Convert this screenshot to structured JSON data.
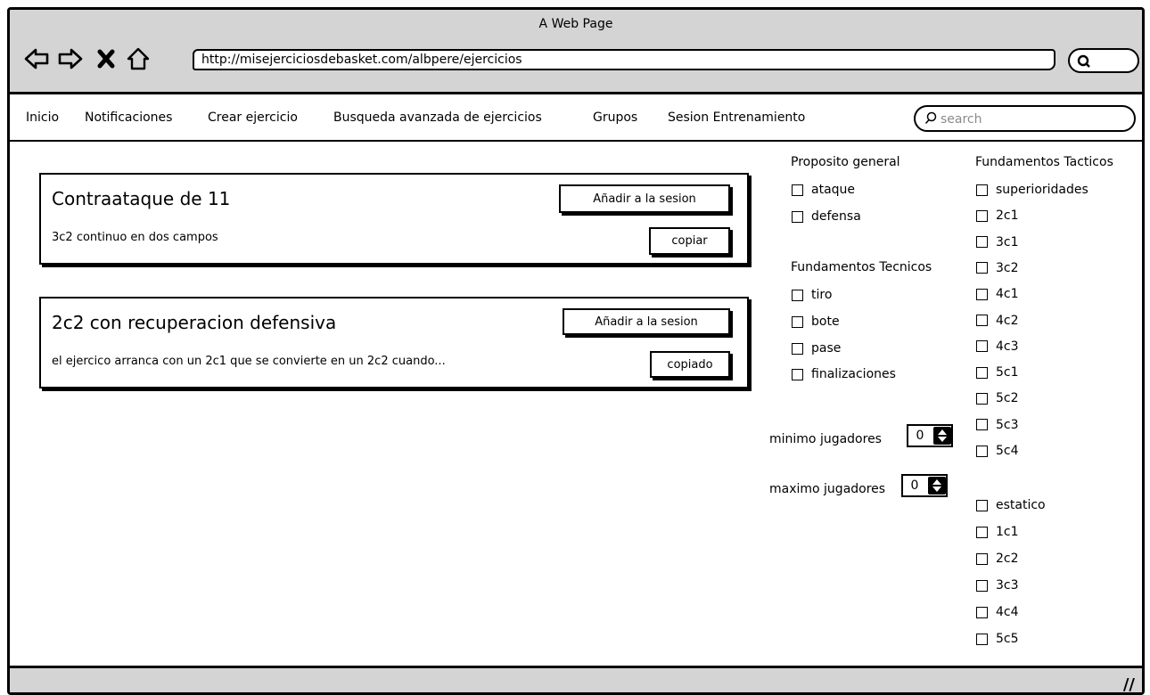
{
  "window": {
    "title": "A Web Page"
  },
  "browser": {
    "url": "http://misejerciciosdebasket.com/albpere/ejercicios",
    "back_icon": "back-arrow-icon",
    "forward_icon": "forward-arrow-icon",
    "stop_icon": "close-icon",
    "home_icon": "home-icon"
  },
  "menu": {
    "items": [
      "Inicio",
      "Notificaciones",
      "Crear ejercicio",
      "Busqueda avanzada de ejercicios",
      "Grupos",
      "Sesion Entrenamiento"
    ],
    "search_placeholder": "search"
  },
  "exercises": [
    {
      "title": "Contraataque de 11",
      "description": "3c2 continuo en dos campos",
      "add_label": "Añadir a la sesion",
      "copy_label": "copiar"
    },
    {
      "title": "2c2 con recuperacion defensiva",
      "description": "el ejercico arranca con un 2c1 que se convierte en un 2c2 cuando...",
      "add_label": "Añadir a la sesion",
      "copy_label": "copiado"
    }
  ],
  "filters": {
    "proposito": {
      "heading": "Proposito general",
      "options": [
        "ataque",
        "defensa"
      ]
    },
    "tecnicos": {
      "heading": "Fundamentos Tecnicos",
      "options": [
        "tiro",
        "bote",
        "pase",
        "finalizaciones"
      ]
    },
    "min_players": {
      "label": "minimo jugadores",
      "value": "0"
    },
    "max_players": {
      "label": "maximo jugadores",
      "value": "0"
    },
    "tacticos": {
      "heading": "Fundamentos Tacticos",
      "options": [
        "superioridades",
        "2c1",
        "3c1",
        "3c2",
        "4c1",
        "4c2",
        "4c3",
        "5c1",
        "5c2",
        "5c3",
        "5c4"
      ],
      "options_equal": [
        "estatico",
        "1c1",
        "2c2",
        "3c3",
        "4c4",
        "5c5"
      ]
    }
  },
  "footer": {
    "grip": "//"
  }
}
